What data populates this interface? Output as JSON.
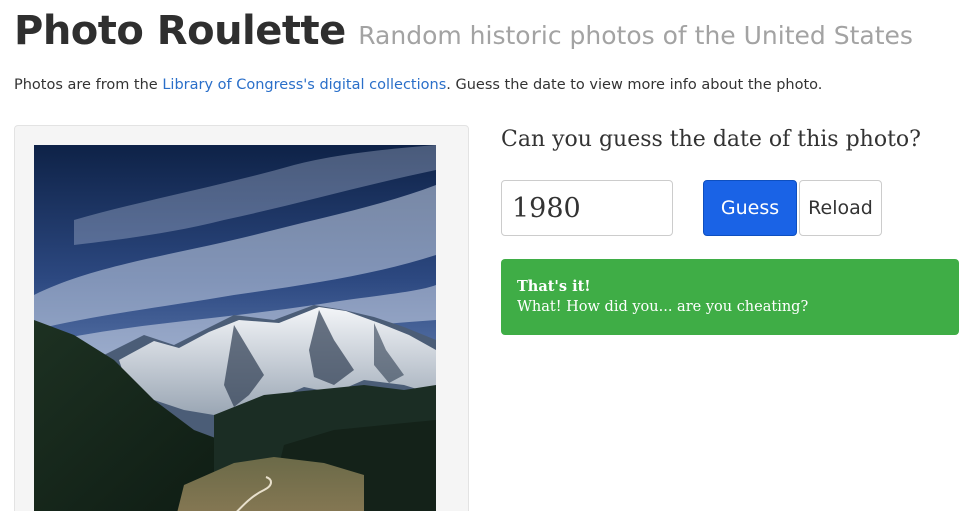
{
  "header": {
    "title": "Photo Roulette",
    "subtitle": "Random historic photos of the United States"
  },
  "intro": {
    "prefix": "Photos are from the ",
    "link_text": "Library of Congress's digital collections",
    "suffix": ". Guess the date to view more info about the photo."
  },
  "photo": {
    "description": "mountain-landscape-photo"
  },
  "quiz": {
    "question": "Can you guess the date of this photo?",
    "year_value": "1980",
    "guess_label": "Guess",
    "reload_label": "Reload"
  },
  "result": {
    "title": "That's it!",
    "message": "What! How did you... are you cheating?",
    "color": "#3fad46"
  },
  "colors": {
    "link": "#2a6fc9",
    "primary_button": "#1a63e6"
  }
}
